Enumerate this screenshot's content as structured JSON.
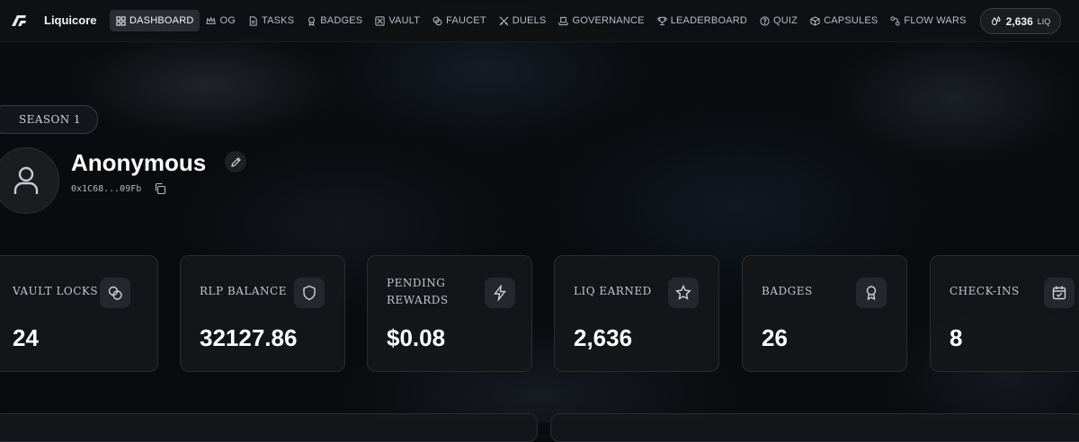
{
  "brand": {
    "name": "Liquicore",
    "logo_icon": "liquicore-logo-icon"
  },
  "nav": {
    "items": [
      {
        "label": "DASHBOARD",
        "icon": "grid-icon",
        "active": true
      },
      {
        "label": "OG",
        "icon": "crown-icon"
      },
      {
        "label": "TASKS",
        "icon": "file-icon"
      },
      {
        "label": "BADGES",
        "icon": "medal-icon"
      },
      {
        "label": "VAULT",
        "icon": "vault-icon"
      },
      {
        "label": "FAUCET",
        "icon": "coins-icon"
      },
      {
        "label": "DUELS",
        "icon": "swords-icon"
      },
      {
        "label": "GOVERNANCE",
        "icon": "ballot-icon"
      },
      {
        "label": "LEADERBOARD",
        "icon": "trophy-icon"
      },
      {
        "label": "QUIZ",
        "icon": "help-circle-icon"
      },
      {
        "label": "CAPSULES",
        "icon": "cube-icon"
      },
      {
        "label": "FLOW WARS",
        "icon": "flow-icon"
      }
    ]
  },
  "balance": {
    "amount": "2,636",
    "unit": "LIQ",
    "icon": "droplets-icon"
  },
  "profile": {
    "season": "SEASON 1",
    "name": "Anonymous",
    "address": "0x1C68...09Fb"
  },
  "stats": [
    {
      "label": "VAULT LOCKS",
      "value": "24",
      "icon": "coins-icon"
    },
    {
      "label": "RLP BALANCE",
      "value": "32127.86",
      "icon": "shield-icon"
    },
    {
      "label": "PENDING REWARDS",
      "value": "$0.08",
      "icon": "lightning-icon"
    },
    {
      "label": "LIQ EARNED",
      "value": "2,636",
      "icon": "star-icon"
    },
    {
      "label": "BADGES",
      "value": "26",
      "icon": "medal-icon"
    },
    {
      "label": "CHECK-INS",
      "value": "8",
      "icon": "calendar-check-icon"
    }
  ],
  "colors": {
    "background": "#0a0b0e",
    "card": "#16171a",
    "text": "#ffffff",
    "muted": "#c3c5cb"
  }
}
